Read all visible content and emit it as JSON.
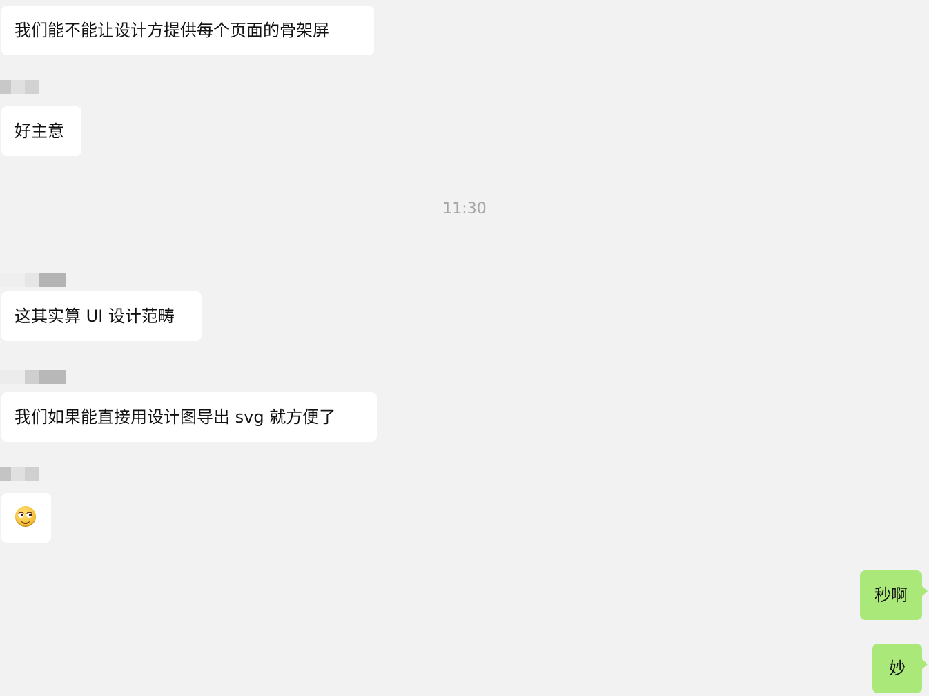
{
  "timestamp": "11:30",
  "messages": [
    {
      "text": "我们能不能让设计方提供每个页面的骨架屏",
      "direction": "incoming"
    },
    {
      "text": "好主意",
      "direction": "incoming"
    },
    {
      "text": "这其实算 UI 设计范畴",
      "direction": "incoming"
    },
    {
      "text": "我们如果能直接用设计图导出 svg 就方便了",
      "direction": "incoming"
    },
    {
      "emoji": "smirk-emoji",
      "direction": "incoming"
    },
    {
      "text": "秒啊",
      "direction": "outgoing"
    },
    {
      "text": "妙",
      "direction": "outgoing"
    }
  ],
  "colors": {
    "background": "#f2f2f2",
    "incoming_bubble": "#ffffff",
    "outgoing_bubble": "#a9e879",
    "timestamp": "#a5a5a5",
    "text": "#111111"
  }
}
